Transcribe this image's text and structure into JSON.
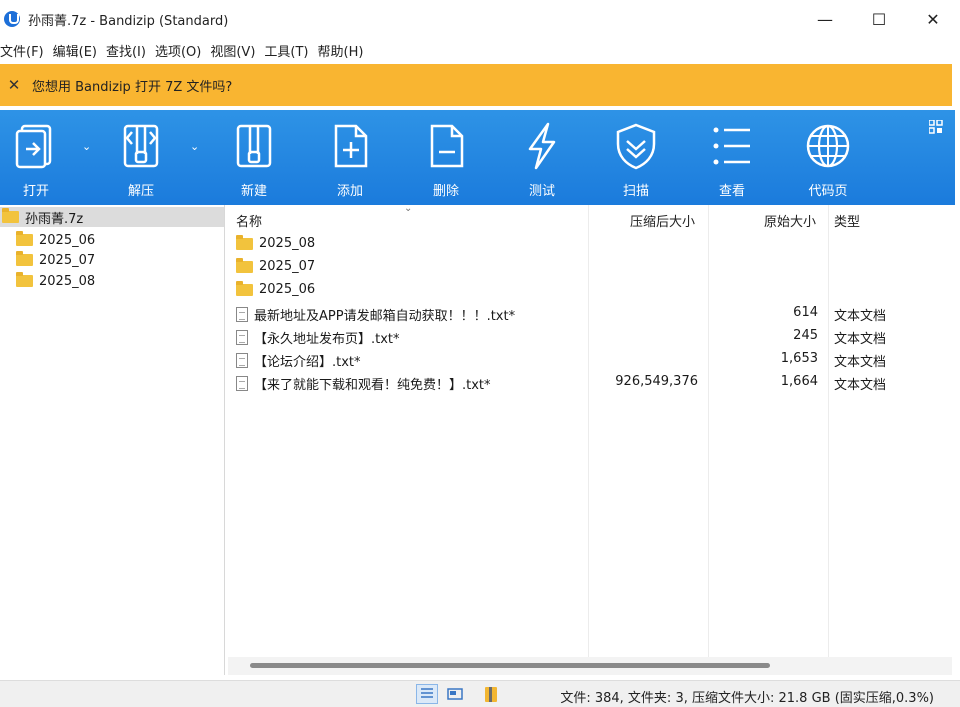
{
  "window": {
    "title": "孙雨菁.7z - Bandizip (Standard)"
  },
  "menu": [
    "文件(F)",
    "编辑(E)",
    "查找(I)",
    "选项(O)",
    "视图(V)",
    "工具(T)",
    "帮助(H)"
  ],
  "notice": {
    "text": "您想用 Bandizip 打开 7Z 文件吗?"
  },
  "toolbar": {
    "open": "打开",
    "extract": "解压",
    "new": "新建",
    "add": "添加",
    "delete": "删除",
    "test": "测试",
    "scan": "扫描",
    "view": "查看",
    "codepage": "代码页"
  },
  "tree": {
    "root": "孙雨菁.7z",
    "children": [
      "2025_06",
      "2025_07",
      "2025_08"
    ]
  },
  "columns": {
    "name": "名称",
    "compressed": "压缩后大小",
    "original": "原始大小",
    "type": "类型"
  },
  "rows": [
    {
      "kind": "folder",
      "name": "2025_08",
      "compressed": "",
      "original": "",
      "type": ""
    },
    {
      "kind": "folder",
      "name": "2025_07",
      "compressed": "",
      "original": "",
      "type": ""
    },
    {
      "kind": "folder",
      "name": "2025_06",
      "compressed": "",
      "original": "",
      "type": ""
    },
    {
      "kind": "file",
      "name": "最新地址及APP请发邮箱自动获取！！！.txt*",
      "compressed": "",
      "original": "614",
      "type": "文本文档"
    },
    {
      "kind": "file",
      "name": "【永久地址发布页】.txt*",
      "compressed": "",
      "original": "245",
      "type": "文本文档"
    },
    {
      "kind": "file",
      "name": "【论坛介绍】.txt*",
      "compressed": "",
      "original": "1,653",
      "type": "文本文档"
    },
    {
      "kind": "file",
      "name": "【来了就能下载和观看！纯免费！】.txt*",
      "compressed": "926,549,376",
      "original": "1,664",
      "type": "文本文档"
    }
  ],
  "status": {
    "text": "文件: 384, 文件夹: 3, 压缩文件大小: 21.8 GB (固实压缩,0.3%)"
  }
}
